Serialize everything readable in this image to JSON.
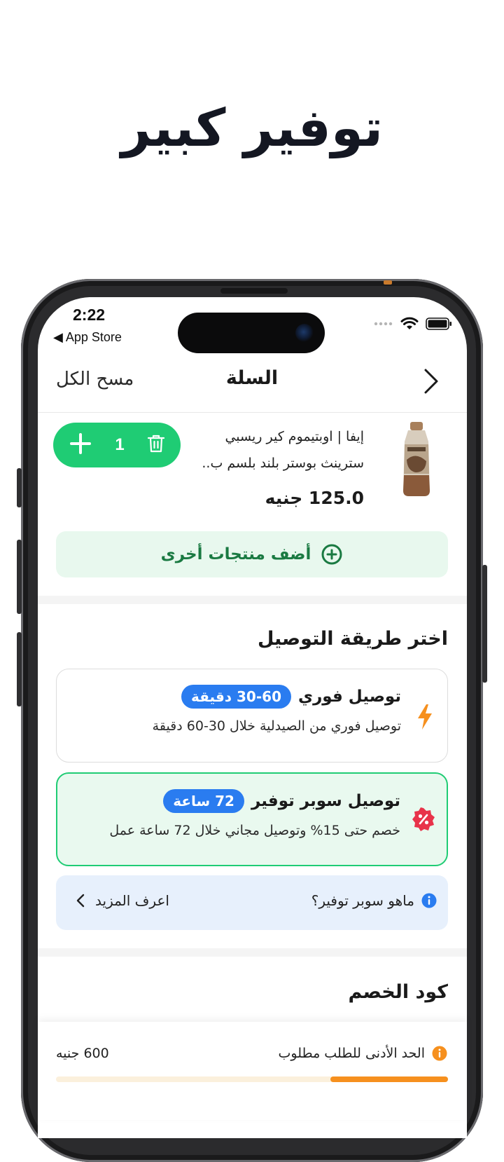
{
  "headline": "توفير كبير",
  "status_bar": {
    "time": "2:22",
    "back_label": "◀ App Store"
  },
  "nav": {
    "title": "السلة",
    "clear_label": "مسح الكل"
  },
  "cart_item": {
    "name_line1": "إيفا | اوبتيموم كير ريسبي",
    "name_line2": "سترينث بوستر بلند بلسم ب..",
    "price": "125.0 جنيه",
    "quantity": "1"
  },
  "add_more_label": "أضف منتجات أخرى",
  "delivery": {
    "section_title": "اختر طريقة التوصيل",
    "options": [
      {
        "title": "توصيل فوري",
        "badge": "30-60 دقيقة",
        "description": "توصيل فوري من الصيدلية خلال 30-60 دقيقة",
        "icon": "lightning-icon",
        "selected": false
      },
      {
        "title": "توصيل سوبر توفير",
        "badge": "72 ساعة",
        "description": "خصم حتى 15% وتوصيل مجاني خلال 72 ساعة عمل",
        "icon": "discount-badge-icon",
        "selected": true
      }
    ]
  },
  "info": {
    "question": "ماهو سوبر توفير؟",
    "learn_more": "اعرف المزيد"
  },
  "discount_section_title": "كود الخصم",
  "min_order": {
    "label": "الحد الأدنى للطلب مطلوب",
    "value": "600 جنيه",
    "progress_fraction": 0.3
  },
  "colors": {
    "green": "#1fcc74",
    "green_light": "#e8f8ee",
    "blue": "#2a7cf0",
    "orange": "#f6901e",
    "red": "#e8334a"
  }
}
